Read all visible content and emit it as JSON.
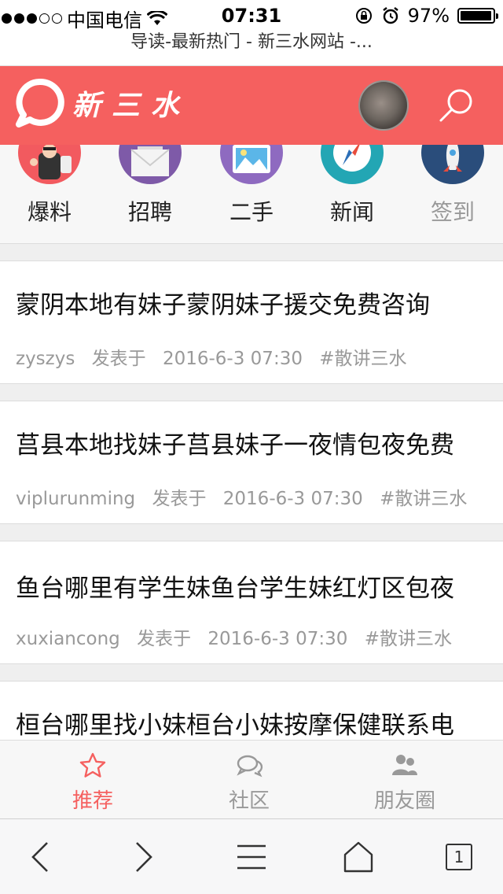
{
  "status_bar": {
    "carrier": "中国电信",
    "time": "07:31",
    "battery": "97%"
  },
  "browser": {
    "page_title": "导读-最新热门 - 新三水网站 -...",
    "tabs_count": "1"
  },
  "header": {
    "logo_text": "新三水"
  },
  "categories": [
    {
      "label": "爆料"
    },
    {
      "label": "招聘"
    },
    {
      "label": "二手"
    },
    {
      "label": "新闻"
    },
    {
      "label": "签到"
    }
  ],
  "posts": [
    {
      "title": "蒙阴本地有妹子蒙阴妹子援交免费咨询",
      "author": "zyszys",
      "verb": "发表于",
      "date": "2016-6-3 07:30",
      "tag": "#散讲三水"
    },
    {
      "title": "莒县本地找妹子莒县妹子一夜情包夜免费",
      "author": "viplurunming",
      "verb": "发表于",
      "date": "2016-6-3 07:30",
      "tag": "#散讲三水"
    },
    {
      "title": "鱼台哪里有学生妹鱼台学生妹红灯区包夜",
      "author": "xuxiancong",
      "verb": "发表于",
      "date": "2016-6-3 07:30",
      "tag": "#散讲三水"
    },
    {
      "title": "桓台哪里找小妹桓台小妹按摩保健联系电",
      "author": "",
      "verb": "",
      "date": "",
      "tag": ""
    }
  ],
  "tabbar": {
    "items": [
      {
        "label": "推荐"
      },
      {
        "label": "社区"
      },
      {
        "label": "朋友圈"
      }
    ]
  },
  "colors": {
    "brand": "#f5605f",
    "meta_text": "#999999"
  }
}
